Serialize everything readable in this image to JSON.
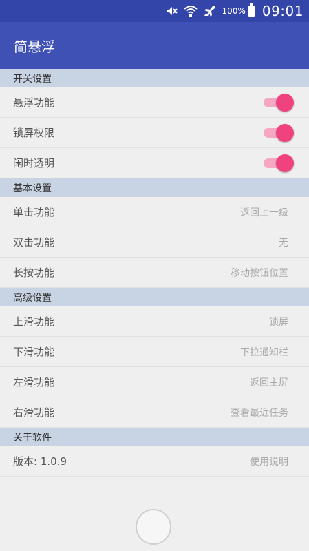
{
  "status_bar": {
    "battery_percent": "100%",
    "time": "09:01",
    "icons": [
      "mute-icon",
      "wifi-icon",
      "airplane-icon",
      "battery-icon"
    ]
  },
  "app_bar": {
    "title": "简悬浮"
  },
  "sections": {
    "switches": {
      "header": "开关设置",
      "items": [
        {
          "label": "悬浮功能",
          "on": true
        },
        {
          "label": "锁屏权限",
          "on": true
        },
        {
          "label": "闲时透明",
          "on": true
        }
      ]
    },
    "basic": {
      "header": "基本设置",
      "items": [
        {
          "label": "单击功能",
          "value": "返回上一级"
        },
        {
          "label": "双击功能",
          "value": "无"
        },
        {
          "label": "长按功能",
          "value": "移动按钮位置"
        }
      ]
    },
    "advanced": {
      "header": "高级设置",
      "items": [
        {
          "label": "上滑功能",
          "value": "锁屏"
        },
        {
          "label": "下滑功能",
          "value": "下拉通知栏"
        },
        {
          "label": "左滑功能",
          "value": "返回主屏"
        },
        {
          "label": "右滑功能",
          "value": "查看最近任务"
        }
      ]
    },
    "about": {
      "header": "关于软件",
      "items": [
        {
          "label": "版本: 1.0.9",
          "value": "使用说明"
        }
      ]
    }
  },
  "colors": {
    "status_bar": "#3345a8",
    "app_bar": "#3f51b5",
    "section_header": "#c8d3e4",
    "toggle_thumb": "#f0427e",
    "toggle_track": "#f5a7c4"
  }
}
